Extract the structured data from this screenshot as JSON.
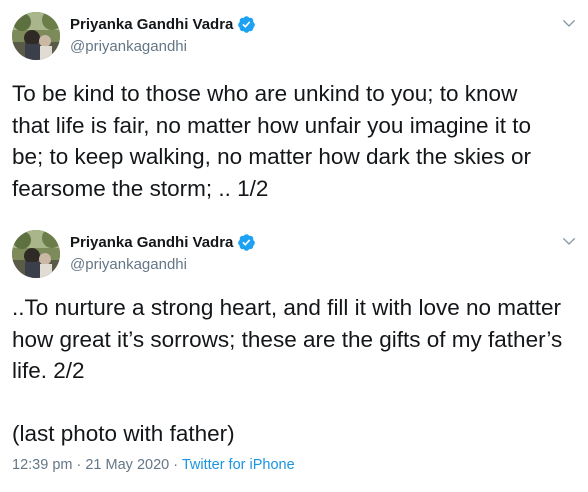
{
  "tweets": [
    {
      "author": {
        "name": "Priyanka Gandhi Vadra",
        "handle": "@priyankagandhi",
        "verified": true,
        "avatar_icon": "profile-photo"
      },
      "text": "To be kind to those who are unkind to you; to know\nthat life is fair, no matter how unfair you imagine it to\nbe; to keep walking, no matter how dark the skies or\nfearsome the storm; .. 1/2"
    },
    {
      "author": {
        "name": "Priyanka Gandhi Vadra",
        "handle": "@priyankagandhi",
        "verified": true,
        "avatar_icon": "profile-photo"
      },
      "text": "..To nurture a strong heart, and fill it with love no matter\nhow great it’s sorrows; these are the gifts of my father’s\nlife. 2/2\n\n(last photo with father)",
      "time": "12:39 pm",
      "separator_1": " · ",
      "date": "21 May 2020",
      "separator_2": " · ",
      "source": "Twitter for iPhone"
    }
  ],
  "colors": {
    "text": "#14171a",
    "secondary": "#657786",
    "link": "#1b95e0",
    "verified": "#1da1f2"
  }
}
